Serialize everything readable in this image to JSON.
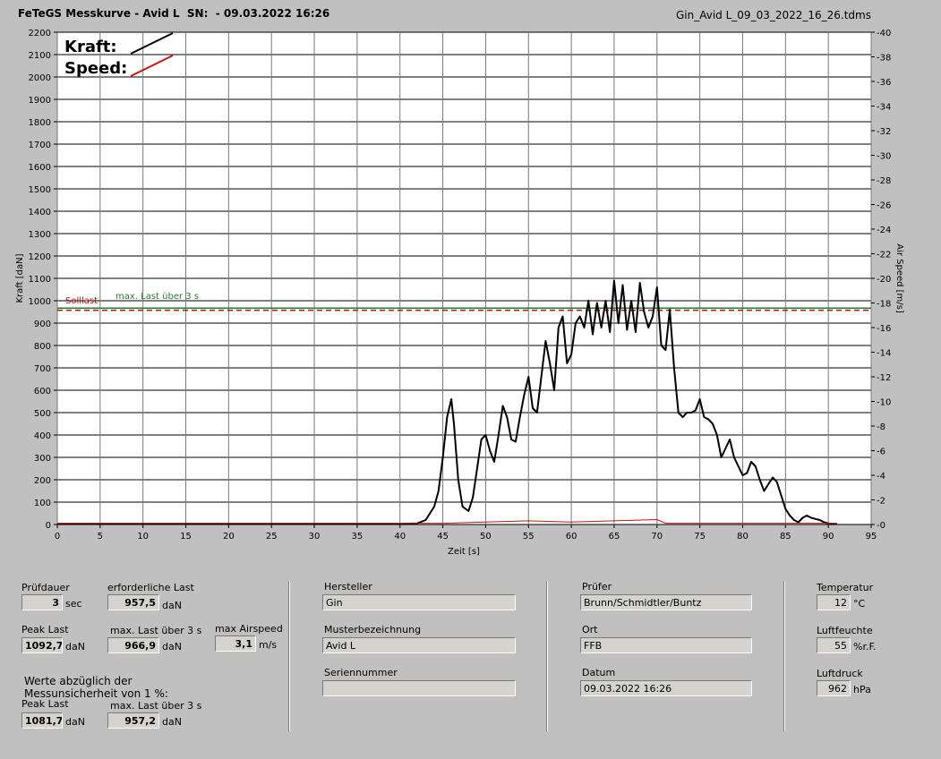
{
  "header": {
    "title": "FeTeGS Messkurve - Avid L  SN:  - 09.03.2022 16:26",
    "filename": "Gin_Avid L_09_03_2022_16_26.tdms"
  },
  "legend": {
    "kraft_label": "Kraft:",
    "speed_label": "Speed:"
  },
  "annotations": {
    "solllast": "Solllast",
    "max_last": "max. Last über  3 s"
  },
  "colors": {
    "background": "#c0c0c0",
    "plot_bg": "#ffffff",
    "kraft": "#000000",
    "speed": "#cc1111",
    "solllast": "#aa1111",
    "max_last": "#2a7a2a"
  },
  "chart_data": {
    "type": "line",
    "xlabel": "Zeit [s]",
    "ylabel": "Kraft [daN]",
    "y2label": "Air Speed [m/s]",
    "xlim": [
      0,
      95
    ],
    "ylim": [
      0,
      2200
    ],
    "y2lim": [
      0,
      40
    ],
    "x_ticks": [
      0,
      5,
      10,
      15,
      20,
      25,
      30,
      35,
      40,
      45,
      50,
      55,
      60,
      65,
      70,
      75,
      80,
      85,
      90,
      95
    ],
    "y_ticks": [
      0,
      100,
      200,
      300,
      400,
      500,
      600,
      700,
      800,
      900,
      1000,
      1100,
      1200,
      1300,
      1400,
      1500,
      1600,
      1700,
      1800,
      1900,
      2000,
      2100,
      2200
    ],
    "y2_ticks": [
      0,
      2,
      4,
      6,
      8,
      10,
      12,
      14,
      16,
      18,
      20,
      22,
      24,
      26,
      28,
      30,
      32,
      34,
      36,
      38,
      40
    ],
    "grid": true,
    "solllast_value": 957.5,
    "max_last_value": 966.9,
    "series": [
      {
        "name": "Kraft",
        "axis": "left",
        "x": [
          0,
          10,
          20,
          30,
          40,
          42,
          43,
          44,
          44.5,
          45,
          45.5,
          46,
          46.3,
          46.8,
          47.3,
          48,
          48.5,
          49,
          49.5,
          50,
          50.5,
          51,
          51.5,
          52,
          52.5,
          53,
          53.5,
          54,
          54.5,
          55,
          55.5,
          56,
          56.5,
          57,
          57.5,
          58,
          58.5,
          59,
          59.5,
          60,
          60.5,
          61,
          61.5,
          62,
          62.5,
          63,
          63.5,
          64,
          64.5,
          65,
          65.5,
          66,
          66.5,
          67,
          67.5,
          68,
          68.5,
          69,
          69.5,
          70,
          70.5,
          71,
          71.5,
          72,
          72.5,
          73,
          73.5,
          74,
          74.5,
          75,
          75.5,
          76,
          76.5,
          77,
          77.5,
          78,
          78.5,
          79,
          79.5,
          80,
          80.5,
          81,
          81.5,
          82,
          82.5,
          83,
          83.5,
          84,
          84.5,
          85,
          85.5,
          86,
          86.5,
          87,
          87.5,
          88,
          88.5,
          89,
          89.5,
          90,
          90.5,
          91
        ],
        "values": [
          3,
          3,
          3,
          3,
          3,
          5,
          20,
          80,
          150,
          300,
          480,
          560,
          450,
          200,
          80,
          60,
          120,
          250,
          380,
          400,
          330,
          280,
          400,
          530,
          480,
          380,
          370,
          480,
          580,
          660,
          520,
          500,
          660,
          820,
          720,
          600,
          880,
          930,
          720,
          760,
          900,
          930,
          880,
          1000,
          850,
          990,
          880,
          1000,
          860,
          1090,
          900,
          1070,
          870,
          1000,
          860,
          1080,
          950,
          880,
          930,
          1060,
          800,
          780,
          960,
          700,
          500,
          480,
          500,
          500,
          510,
          560,
          480,
          470,
          450,
          400,
          300,
          340,
          380,
          300,
          260,
          220,
          230,
          280,
          260,
          200,
          150,
          180,
          210,
          190,
          130,
          70,
          40,
          20,
          10,
          30,
          40,
          30,
          25,
          20,
          10,
          5,
          3,
          2
        ]
      },
      {
        "name": "Speed",
        "axis": "right",
        "x": [
          0,
          45,
          50,
          55,
          60,
          65,
          70,
          71,
          75,
          80,
          85,
          91
        ],
        "values": [
          0.1,
          0.1,
          0.2,
          0.3,
          0.2,
          0.3,
          0.4,
          0.1,
          0.1,
          0.1,
          0.1,
          0.1
        ]
      }
    ]
  },
  "panel": {
    "pruefdauer": {
      "label": "Prüfdauer",
      "value": "3",
      "unit": "sec"
    },
    "erforderliche_last": {
      "label": "erforderliche Last",
      "value": "957,5",
      "unit": "daN"
    },
    "peak_last": {
      "label": "Peak Last",
      "value": "1092,7",
      "unit": "daN"
    },
    "max_last": {
      "label": "max. Last über  3 s",
      "value": "966,9",
      "unit": "daN"
    },
    "max_airspeed": {
      "label": "max Airspeed",
      "value": "3,1",
      "unit": "m/s"
    },
    "werte_text1": "Werte abzüglich der",
    "werte_text2": "Messunsicherheit von 1  %:",
    "peak_last2": {
      "label": "Peak Last",
      "value": "1081,7",
      "unit": "daN"
    },
    "max_last2": {
      "label": "max. Last über  3 s",
      "value": "957,2",
      "unit": "daN"
    },
    "hersteller": {
      "label": "Hersteller",
      "value": "Gin"
    },
    "musterbezeichnung": {
      "label": "Musterbezeichnung",
      "value": "Avid L"
    },
    "seriennummer": {
      "label": "Seriennummer",
      "value": ""
    },
    "pruefer": {
      "label": "Prüfer",
      "value": "Brunn/Schmidtler/Buntz"
    },
    "ort": {
      "label": "Ort",
      "value": "FFB"
    },
    "datum": {
      "label": "Datum",
      "value": "09.03.2022 16:26"
    },
    "temperatur": {
      "label": "Temperatur",
      "value": "12",
      "unit": "°C"
    },
    "luftfeuchte": {
      "label": "Luftfeuchte",
      "value": "55",
      "unit": "%r.F."
    },
    "luftdruck": {
      "label": "Luftdruck",
      "value": "962",
      "unit": "hPa"
    }
  }
}
